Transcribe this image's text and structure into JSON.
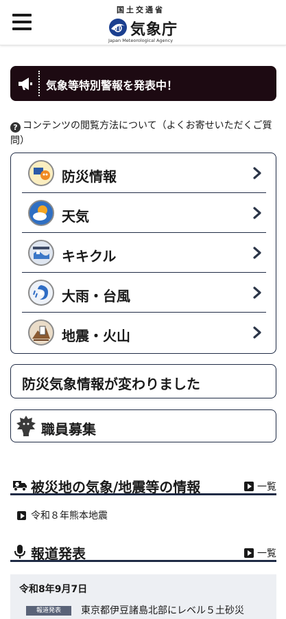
{
  "header": {
    "ministry": "国土交通省",
    "agency": "気象庁",
    "agency_en": "Japan Meteorological Agency",
    "menu_icon": "hamburger-icon"
  },
  "alert": {
    "icon": "megaphone-icon",
    "text": "気象等特別警報を発表中！",
    "background": "#1d0a12"
  },
  "help": {
    "icon": "question-circle-icon",
    "text": "コンテンツの閲覧方法について（よくお寄せいただくご質問）"
  },
  "menu": {
    "items": [
      {
        "label": "防災情報",
        "icon": "disaster-info-icon"
      },
      {
        "label": "天気",
        "icon": "weather-icon"
      },
      {
        "label": "キキクル",
        "icon": "kikikuru-icon"
      },
      {
        "label": "大雨・台風",
        "icon": "typhoon-icon"
      },
      {
        "label": "地震・火山",
        "icon": "earthquake-icon"
      }
    ]
  },
  "notice": {
    "label": "防災気象情報が変わりました"
  },
  "recruit": {
    "label": "職員募集",
    "icon": "mascot-icon"
  },
  "sections": {
    "disaster_area": {
      "title": "被災地の気象/地震等の情報",
      "icon": "truck-icon",
      "link": "一覧",
      "items": [
        "令和８年熊本地震"
      ]
    },
    "press": {
      "title": "報道発表",
      "icon": "microphone-icon",
      "link": "一覧",
      "entries": [
        {
          "date": "令和8年9月7日",
          "badge": "報道発表",
          "text": "東京都伊豆諸島北部にレベル５土砂災"
        }
      ]
    }
  },
  "colors": {
    "border": "#1f2b45",
    "news_bg": "#edeff3",
    "badge_bg": "#5a6378"
  }
}
